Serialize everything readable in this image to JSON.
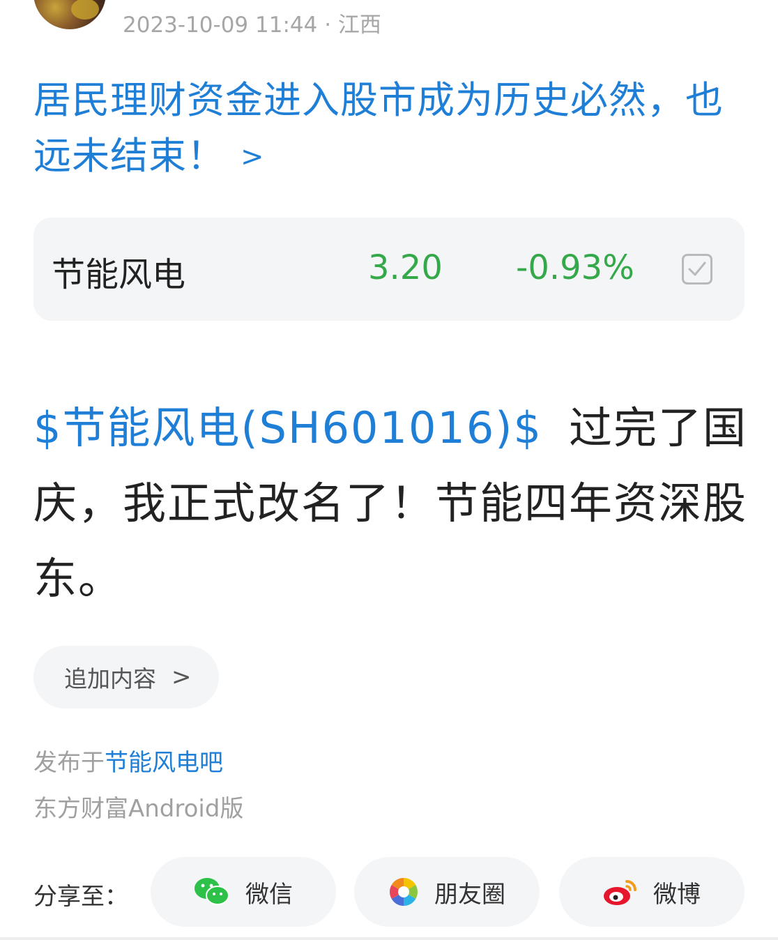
{
  "post": {
    "meta": "2023-10-09 11:44 · 江西",
    "headline": "居民理财资金进入股市成为历史必然，也远未结束！",
    "headline_chevron": ">",
    "stock_tag": "$节能风电(SH601016)$",
    "body_text": "过完了国庆，我正式改名了！节能四年资深股东。"
  },
  "stock_card": {
    "name": "节能风电",
    "price": "3.20",
    "change": "-0.93%",
    "color_down": "#35a84a"
  },
  "add_content": {
    "label": "追加内容",
    "chevron": ">"
  },
  "footer": {
    "published_prefix": "发布于",
    "forum": "节能风电吧",
    "client": "东方财富Android版"
  },
  "share": {
    "label": "分享至：",
    "buttons": [
      {
        "label": "微信",
        "icon": "wechat-icon"
      },
      {
        "label": "朋友圈",
        "icon": "moments-icon"
      },
      {
        "label": "微博",
        "icon": "weibo-icon"
      }
    ]
  },
  "colors": {
    "link": "#1f7fd6",
    "text": "#222222",
    "muted": "#a0a0a0",
    "card_bg": "#f4f5f7"
  }
}
